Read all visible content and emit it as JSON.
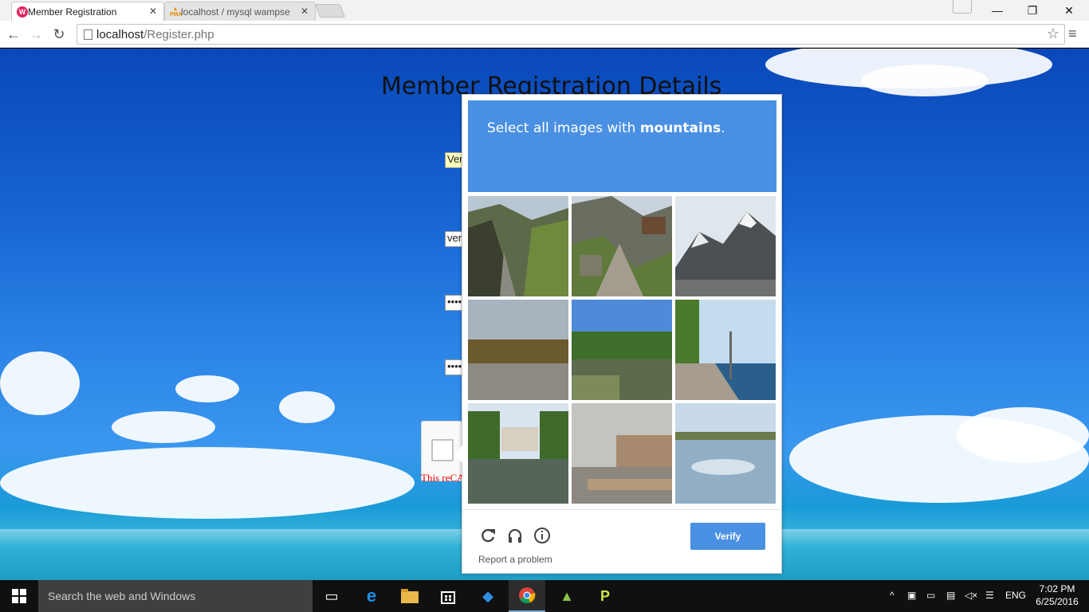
{
  "browser": {
    "tabs": [
      {
        "label": "Member Registration",
        "active": true
      },
      {
        "label": "localhost / mysql wampse",
        "active": false
      }
    ],
    "address": {
      "host": "localhost",
      "path": "/Register.php"
    }
  },
  "page": {
    "title": "Member Registration Details",
    "fields": [
      {
        "value": "Ver",
        "type": "text",
        "autofill": true
      },
      {
        "value": "ver",
        "type": "text",
        "autofill": false
      },
      {
        "value": "••••",
        "type": "password",
        "autofill": false
      },
      {
        "value": "••••",
        "type": "password",
        "autofill": false
      }
    ],
    "recaptcha_error": "This reCA"
  },
  "challenge": {
    "instruction_prefix": "Select all images with ",
    "instruction_keyword": "mountains",
    "instruction_suffix": ".",
    "tiles": [
      {
        "subject": "mountain valley"
      },
      {
        "subject": "mountain village path"
      },
      {
        "subject": "snowy mountain"
      },
      {
        "subject": "lake at dusk"
      },
      {
        "subject": "pond with trees"
      },
      {
        "subject": "lakeside promenade"
      },
      {
        "subject": "river with palace"
      },
      {
        "subject": "misty pier"
      },
      {
        "subject": "calm lake reflection"
      }
    ],
    "report_label": "Report a problem",
    "verify_label": "Verify",
    "icons": [
      "reload-icon",
      "headphones-icon",
      "info-icon"
    ]
  },
  "taskbar": {
    "search_placeholder": "Search the web and Windows",
    "language": "ENG",
    "time": "7:02 PM",
    "date": "6/25/2016"
  },
  "colors": {
    "challenge_header": "#4a90e2",
    "verify_button": "#4a90e2",
    "error_text": "#ee0000",
    "autofill": "#faffbd"
  }
}
